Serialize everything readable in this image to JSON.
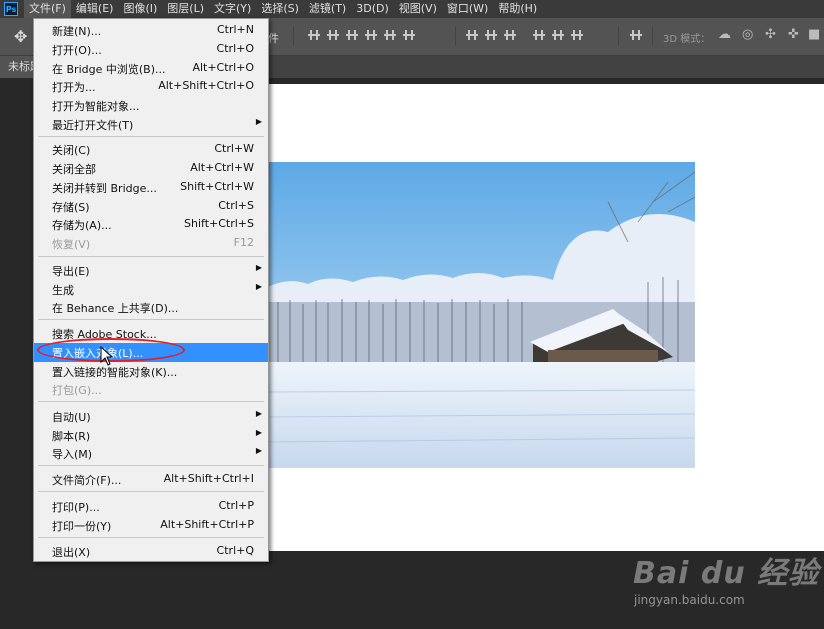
{
  "menubar": {
    "logo": "Ps",
    "items": [
      "文件(F)",
      "编辑(E)",
      "图像(I)",
      "图层(L)",
      "文字(Y)",
      "选择(S)",
      "滤镜(T)",
      "3D(D)",
      "视图(V)",
      "窗口(W)",
      "帮助(H)"
    ]
  },
  "options": {
    "partial_label": "件",
    "mode_3d_label": "3D 模式："
  },
  "tab": {
    "title": "未标题"
  },
  "file_menu": {
    "items": [
      {
        "label": "新建(N)...",
        "shortcut": "Ctrl+N"
      },
      {
        "label": "打开(O)...",
        "shortcut": "Ctrl+O"
      },
      {
        "label": "在 Bridge 中浏览(B)...",
        "shortcut": "Alt+Ctrl+O"
      },
      {
        "label": "打开为...",
        "shortcut": "Alt+Shift+Ctrl+O"
      },
      {
        "label": "打开为智能对象...",
        "shortcut": ""
      },
      {
        "label": "最近打开文件(T)",
        "shortcut": "",
        "submenu": true
      },
      {
        "label": "关闭(C)",
        "shortcut": "Ctrl+W"
      },
      {
        "label": "关闭全部",
        "shortcut": "Alt+Ctrl+W"
      },
      {
        "label": "关闭并转到 Bridge...",
        "shortcut": "Shift+Ctrl+W"
      },
      {
        "label": "存储(S)",
        "shortcut": "Ctrl+S"
      },
      {
        "label": "存储为(A)...",
        "shortcut": "Shift+Ctrl+S"
      },
      {
        "label": "恢复(V)",
        "shortcut": "F12",
        "disabled": true
      },
      {
        "label": "导出(E)",
        "shortcut": "",
        "submenu": true
      },
      {
        "label": "生成",
        "shortcut": "",
        "submenu": true
      },
      {
        "label": "在 Behance 上共享(D)...",
        "shortcut": ""
      },
      {
        "label": "搜索 Adobe Stock...",
        "shortcut": ""
      },
      {
        "label": "置入嵌入对象(L)...",
        "shortcut": "",
        "highlighted": true
      },
      {
        "label": "置入链接的智能对象(K)...",
        "shortcut": ""
      },
      {
        "label": "打包(G)...",
        "shortcut": "",
        "disabled": true
      },
      {
        "label": "自动(U)",
        "shortcut": "",
        "submenu": true
      },
      {
        "label": "脚本(R)",
        "shortcut": "",
        "submenu": true
      },
      {
        "label": "导入(M)",
        "shortcut": "",
        "submenu": true
      },
      {
        "label": "文件简介(F)...",
        "shortcut": "Alt+Shift+Ctrl+I"
      },
      {
        "label": "打印(P)...",
        "shortcut": "Ctrl+P"
      },
      {
        "label": "打印一份(Y)",
        "shortcut": "Alt+Shift+Ctrl+P"
      },
      {
        "label": "退出(X)",
        "shortcut": "Ctrl+Q"
      }
    ]
  },
  "watermark": {
    "main": "Bai du 经验",
    "sub": "jingyan.baidu.com"
  },
  "colors": {
    "highlight": "#3390ff",
    "annotation_ring": "#e0202a"
  }
}
